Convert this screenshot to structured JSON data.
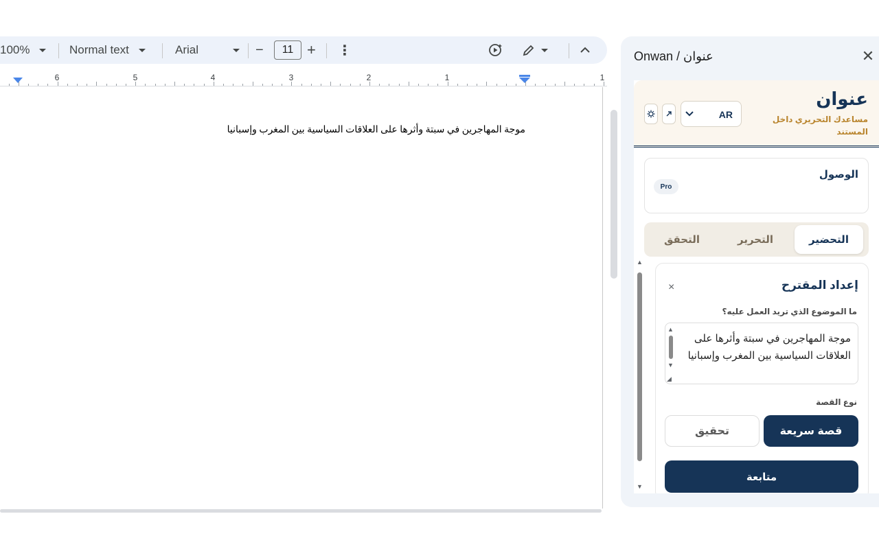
{
  "toolbar": {
    "zoom": "100%",
    "style": "Normal text",
    "font": "Arial",
    "font_size": "11",
    "minus": "−",
    "plus": "+",
    "more": "⋮",
    "edit_mode_icon": "pencil-icon",
    "collapse": "^"
  },
  "ruler": {
    "numbers": [
      "6",
      "5",
      "4",
      "3",
      "2",
      "1",
      "1"
    ]
  },
  "document": {
    "text": "موجة المهاجرين في سبتة وأثرها على العلاقات السياسية بين المغرب وإسبانيا"
  },
  "side_panel": {
    "title": "Onwan / عنوان",
    "close": "✕"
  },
  "addon": {
    "brand": "عنوان",
    "subtitle": "مساعدك التحريري داخل المستند",
    "language": "AR",
    "access": {
      "title": "الوصول",
      "badge": "Pro"
    },
    "tabs": [
      "التحضير",
      "التحرير",
      "التحقق"
    ],
    "active_tab": "التحضير",
    "card": {
      "title": "إعداد المقترح",
      "close": "×",
      "topic_label": "ما الموضوع الذي تريد العمل عليه؟",
      "topic_value": "موجة المهاجرين في سبتة وأثرها على العلاقات السياسية بين المغرب وإسبانيا",
      "story_type_label": "نوع القصة",
      "story_type_options": [
        "قصة سريعة",
        "تحقيق"
      ],
      "selected_story_type": "قصة سريعة",
      "continue_label": "متابعة"
    },
    "colors": {
      "navy": "#163457",
      "gold": "#b9852e",
      "header_bg": "#fbf6ee"
    }
  }
}
